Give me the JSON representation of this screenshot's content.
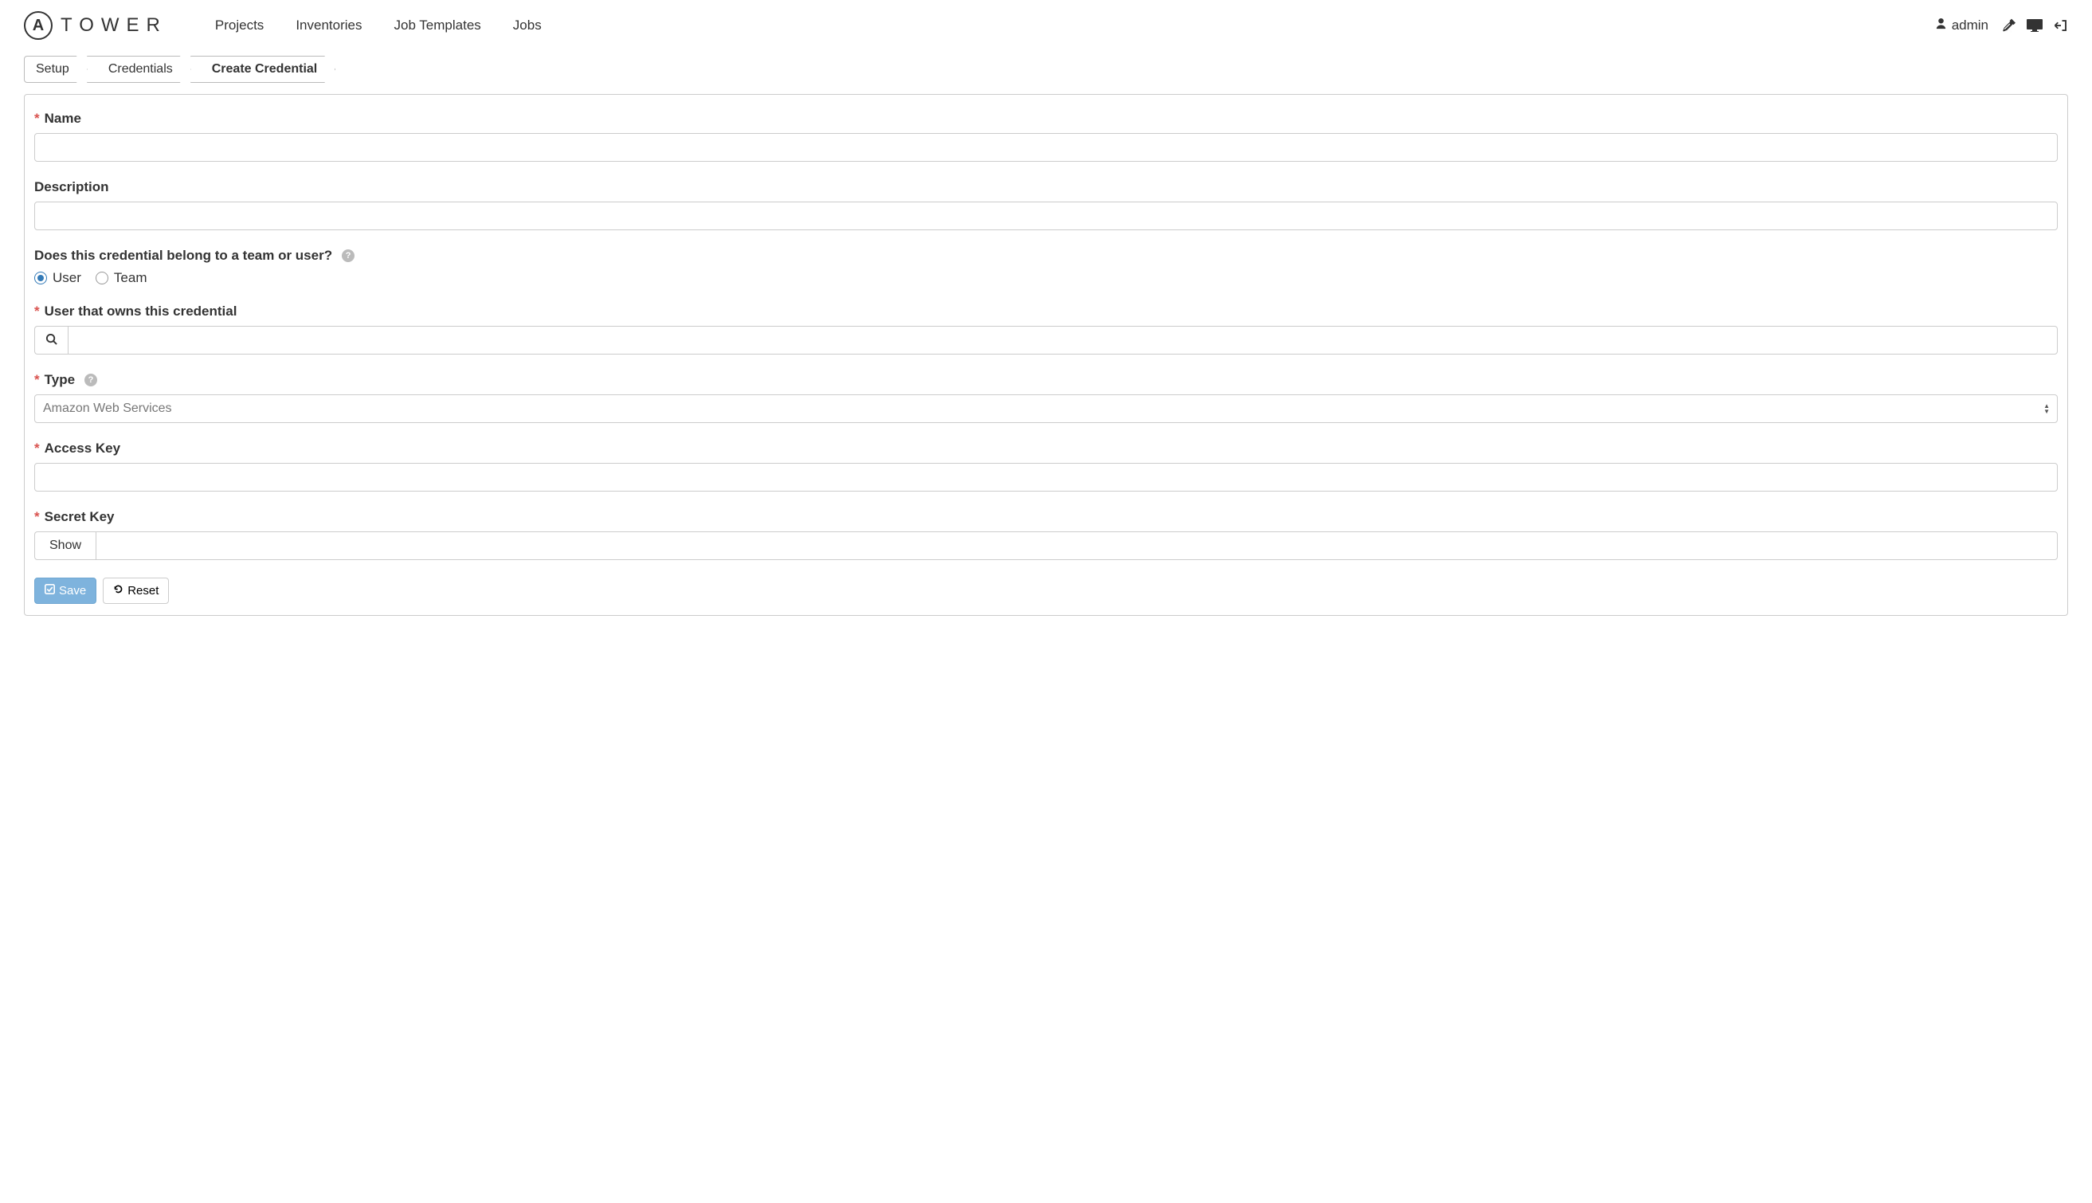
{
  "header": {
    "logo_letter": "A",
    "logo_text": "TOWER",
    "nav": {
      "projects": "Projects",
      "inventories": "Inventories",
      "job_templates": "Job Templates",
      "jobs": "Jobs"
    },
    "username": "admin"
  },
  "breadcrumb": {
    "setup": "Setup",
    "credentials": "Credentials",
    "create": "Create Credential"
  },
  "form": {
    "name_label": "Name",
    "name_value": "",
    "description_label": "Description",
    "description_value": "",
    "owner_question": "Does this credential belong to a team or user?",
    "radio_user": "User",
    "radio_team": "Team",
    "owner_user_label": "User that owns this credential",
    "owner_user_value": "",
    "type_label": "Type",
    "type_value": "Amazon Web Services",
    "access_key_label": "Access Key",
    "access_key_value": "",
    "secret_key_label": "Secret Key",
    "secret_key_value": "",
    "show_button": "Show",
    "save_button": "Save",
    "reset_button": "Reset"
  }
}
